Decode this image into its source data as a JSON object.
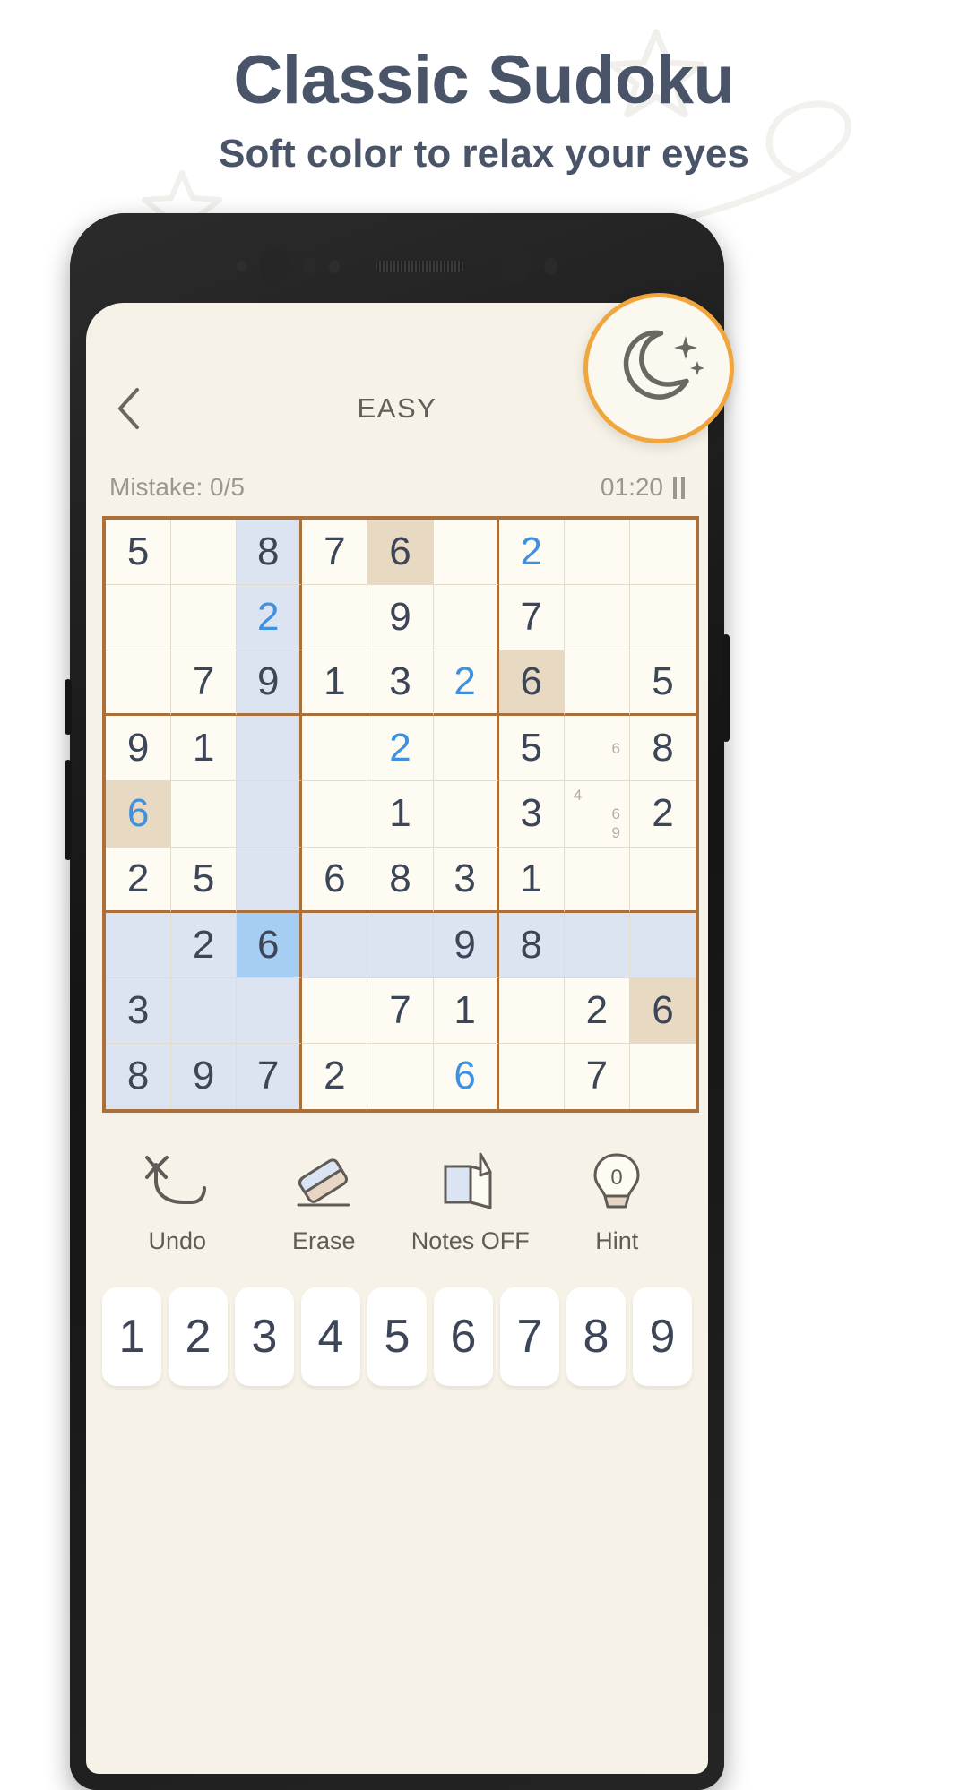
{
  "promo": {
    "title": "Classic Sudoku",
    "subtitle": "Soft color to relax your eyes",
    "title_color": "#4a5468"
  },
  "statusbar": {
    "icons": [
      "wifi-icon",
      "signal-icon",
      "battery-icon"
    ]
  },
  "appbar": {
    "back_icon": "chevron-left-icon",
    "title": "EASY"
  },
  "inforow": {
    "mistakes_label": "Mistake: 0/5",
    "timer": "01:20",
    "pause_icon": "pause-icon"
  },
  "night_badge": {
    "icon": "moon-icon",
    "ring_color": "#f0a63c"
  },
  "board": {
    "colors": {
      "given": "#3c4657",
      "user": "#3e90e0",
      "grid_line": "#a9703c",
      "highlight_row_col": "#dde4f1",
      "highlight_same": "#e8d9c3",
      "selected": "#a6cdf2",
      "cell_bg": "#fdfbf2"
    },
    "selected_cell": {
      "row": 6,
      "col": 2,
      "value": "6"
    },
    "cells": [
      [
        {
          "v": "5"
        },
        {
          "v": ""
        },
        {
          "v": "8",
          "hl": true
        },
        {
          "v": "7"
        },
        {
          "v": "6",
          "same": true
        },
        {
          "v": ""
        },
        {
          "v": "2",
          "user": true
        },
        {
          "v": ""
        },
        {
          "v": ""
        }
      ],
      [
        {
          "v": ""
        },
        {
          "v": ""
        },
        {
          "v": "2",
          "user": true,
          "hl": true
        },
        {
          "v": ""
        },
        {
          "v": "9"
        },
        {
          "v": ""
        },
        {
          "v": "7"
        },
        {
          "v": ""
        },
        {
          "v": ""
        }
      ],
      [
        {
          "v": ""
        },
        {
          "v": "7"
        },
        {
          "v": "9",
          "hl": true
        },
        {
          "v": "1"
        },
        {
          "v": "3"
        },
        {
          "v": "2",
          "user": true
        },
        {
          "v": "6",
          "same": true
        },
        {
          "v": ""
        },
        {
          "v": "5"
        }
      ],
      [
        {
          "v": "9"
        },
        {
          "v": "1"
        },
        {
          "v": "",
          "hl": true
        },
        {
          "v": ""
        },
        {
          "v": "2",
          "user": true
        },
        {
          "v": ""
        },
        {
          "v": "5"
        },
        {
          "v": "",
          "notes": [
            "",
            "",
            "",
            "",
            "",
            "6",
            "",
            "",
            ""
          ]
        },
        {
          "v": "8"
        }
      ],
      [
        {
          "v": "6",
          "user": true,
          "same": true
        },
        {
          "v": ""
        },
        {
          "v": "",
          "hl": true
        },
        {
          "v": ""
        },
        {
          "v": "1"
        },
        {
          "v": ""
        },
        {
          "v": "3"
        },
        {
          "v": "",
          "notes": [
            "4",
            "",
            "",
            "",
            "",
            "6",
            "",
            "",
            "9"
          ]
        },
        {
          "v": "2"
        }
      ],
      [
        {
          "v": "2"
        },
        {
          "v": "5"
        },
        {
          "v": "",
          "hl": true
        },
        {
          "v": "6"
        },
        {
          "v": "8"
        },
        {
          "v": "3"
        },
        {
          "v": "1"
        },
        {
          "v": ""
        },
        {
          "v": ""
        }
      ],
      [
        {
          "v": "",
          "hl": true
        },
        {
          "v": "2",
          "hl": true
        },
        {
          "v": "6",
          "sel": true
        },
        {
          "v": "",
          "hl": true
        },
        {
          "v": "",
          "hl": true
        },
        {
          "v": "9",
          "hl": true
        },
        {
          "v": "8",
          "hl": true
        },
        {
          "v": "",
          "hl": true
        },
        {
          "v": "",
          "hl": true
        }
      ],
      [
        {
          "v": "3",
          "hl": true
        },
        {
          "v": "",
          "hl": true
        },
        {
          "v": "",
          "hl": true
        },
        {
          "v": ""
        },
        {
          "v": "7"
        },
        {
          "v": "1"
        },
        {
          "v": ""
        },
        {
          "v": "2"
        },
        {
          "v": "6",
          "same": true
        }
      ],
      [
        {
          "v": "8",
          "hl": true
        },
        {
          "v": "9",
          "hl": true
        },
        {
          "v": "7",
          "hl": true
        },
        {
          "v": "2"
        },
        {
          "v": ""
        },
        {
          "v": "6",
          "user": true
        },
        {
          "v": ""
        },
        {
          "v": "7"
        },
        {
          "v": ""
        }
      ]
    ]
  },
  "toolbar": [
    {
      "label": "Undo",
      "icon": "undo-icon"
    },
    {
      "label": "Erase",
      "icon": "eraser-icon"
    },
    {
      "label": "Notes OFF",
      "icon": "notes-icon"
    },
    {
      "label": "Hint",
      "icon": "lightbulb-icon",
      "badge": "0"
    }
  ],
  "numpad": [
    "1",
    "2",
    "3",
    "4",
    "5",
    "6",
    "7",
    "8",
    "9"
  ]
}
